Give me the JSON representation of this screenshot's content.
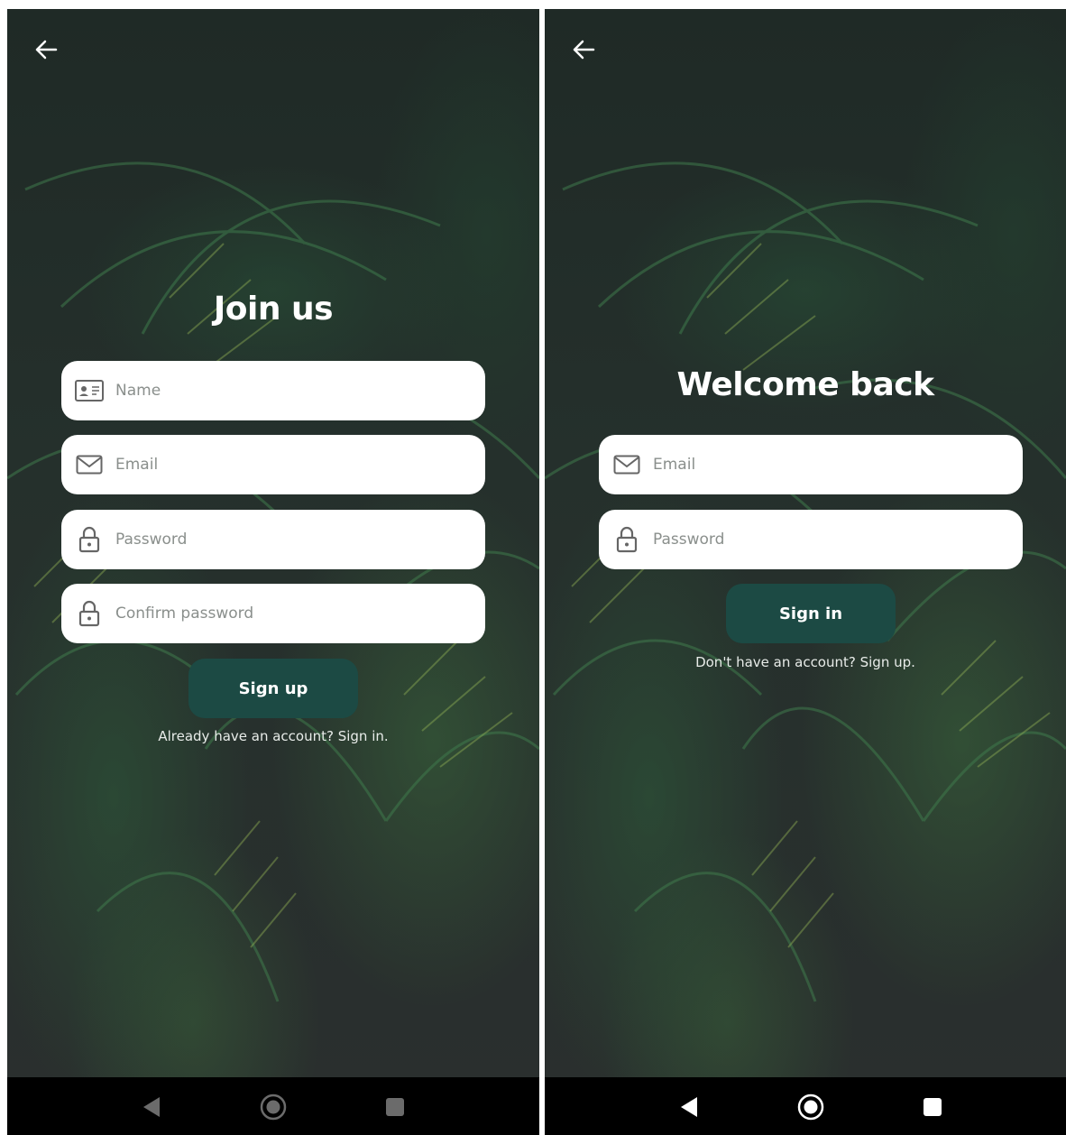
{
  "colors": {
    "button": "#1c4a44",
    "field_bg": "#ffffff",
    "placeholder": "#8a8f8c",
    "navbar": "#000000",
    "left_nav_icons": "#6b6b6b",
    "right_nav_icons": "#ffffff"
  },
  "signup": {
    "back_icon": "arrow-left-icon",
    "title": "Join us",
    "fields": {
      "name": {
        "placeholder": "Name",
        "icon": "id-card-icon"
      },
      "email": {
        "placeholder": "Email",
        "icon": "mail-icon"
      },
      "password": {
        "placeholder": "Password",
        "icon": "lock-icon"
      },
      "confirm": {
        "placeholder": "Confirm password",
        "icon": "lock-icon"
      }
    },
    "button_label": "Sign up",
    "switch_link": "Already have an account? Sign in."
  },
  "signin": {
    "back_icon": "arrow-left-icon",
    "title": "Welcome back",
    "fields": {
      "email": {
        "placeholder": "Email",
        "icon": "mail-icon"
      },
      "password": {
        "placeholder": "Password",
        "icon": "lock-icon"
      }
    },
    "button_label": "Sign in",
    "switch_link": "Don't have an account? Sign up."
  },
  "navbar": {
    "items": [
      "back-triangle-icon",
      "home-circle-icon",
      "recents-square-icon"
    ]
  }
}
